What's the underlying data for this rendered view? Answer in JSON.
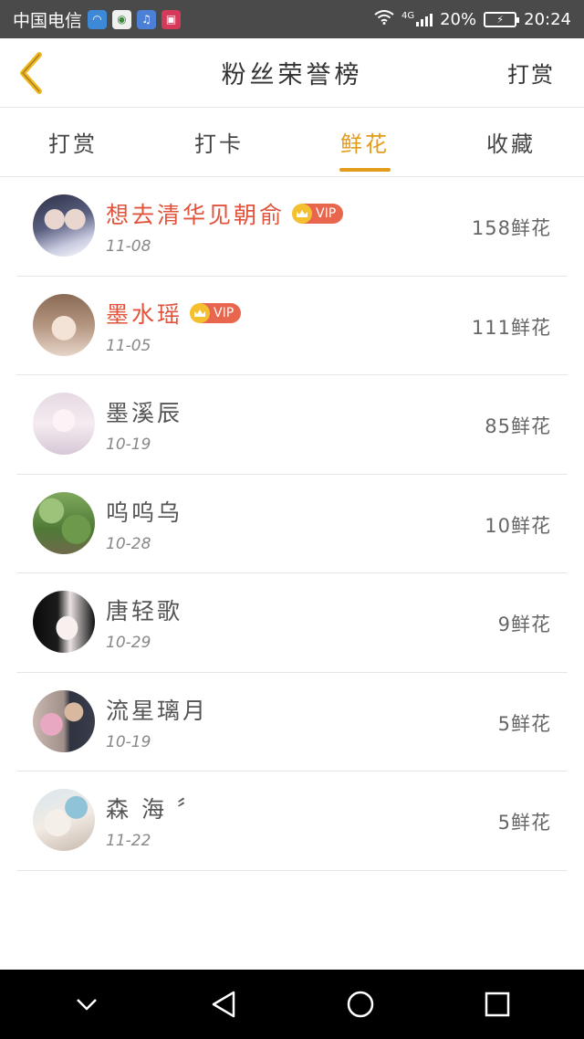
{
  "status_bar": {
    "carrier": "中国电信",
    "network": "4G",
    "battery": "20%",
    "time": "20:24"
  },
  "header": {
    "title": "粉丝荣誉榜",
    "action_label": "打赏"
  },
  "tabs": [
    {
      "label": "打赏",
      "active": false
    },
    {
      "label": "打卡",
      "active": false
    },
    {
      "label": "鲜花",
      "active": true
    },
    {
      "label": "收藏",
      "active": false
    }
  ],
  "vip_label": "VIP",
  "fans": [
    {
      "name": "想去清华见朝俞",
      "date": "11-08",
      "amount": "158鲜花",
      "vip": true
    },
    {
      "name": "墨水瑶",
      "date": "11-05",
      "amount": "111鲜花",
      "vip": true
    },
    {
      "name": "墨溪辰",
      "date": "10-19",
      "amount": "85鲜花",
      "vip": false
    },
    {
      "name": "呜呜乌",
      "date": "10-28",
      "amount": "10鲜花",
      "vip": false
    },
    {
      "name": "唐轻歌",
      "date": "10-29",
      "amount": "9鲜花",
      "vip": false
    },
    {
      "name": "流星璃月",
      "date": "10-19",
      "amount": "5鲜花",
      "vip": false
    },
    {
      "name": "森 海 〞",
      "date": "11-22",
      "amount": "5鲜花",
      "vip": false
    }
  ],
  "colors": {
    "accent": "#e39b1a",
    "vip_name": "#e2533c",
    "vip_badge": "#e8664e"
  }
}
